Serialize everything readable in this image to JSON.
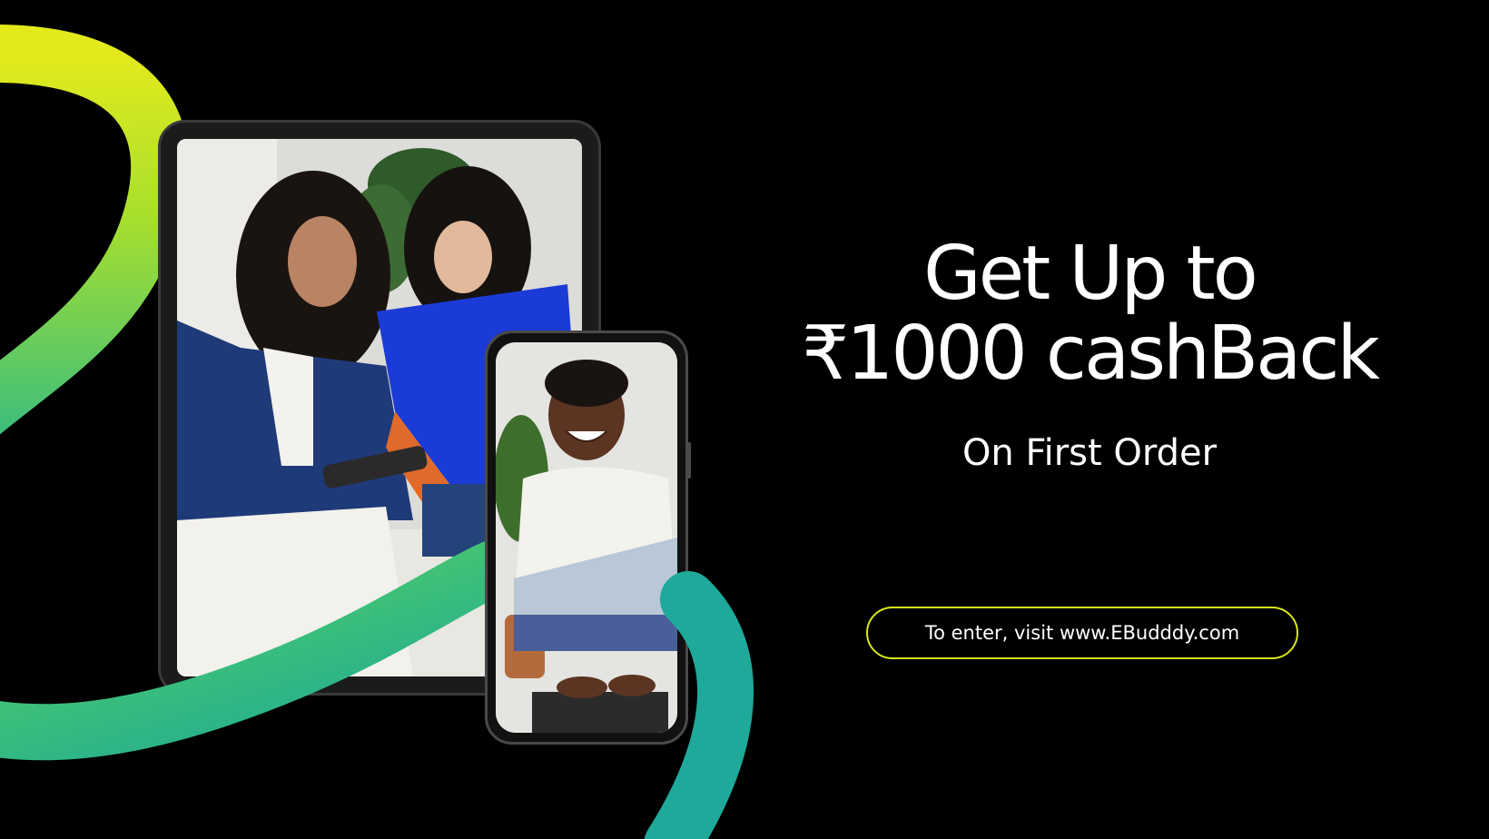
{
  "headline": {
    "line1": "Get Up to",
    "line2": "₹1000 cashBack"
  },
  "subheadline": "On First Order",
  "cta": {
    "text": "To enter, visit www.EBudddy.com"
  },
  "colors": {
    "background": "#000000",
    "text": "#ffffff",
    "cta_border": "#d9e81a",
    "ribbon_start": "#e3ea1c",
    "ribbon_mid": "#7ed957",
    "ribbon_end": "#1aa59a"
  },
  "images": {
    "tablet_photo": "two-people-looking-at-phone-photo",
    "phone_photo": "smiling-man-at-laptop-photo"
  }
}
